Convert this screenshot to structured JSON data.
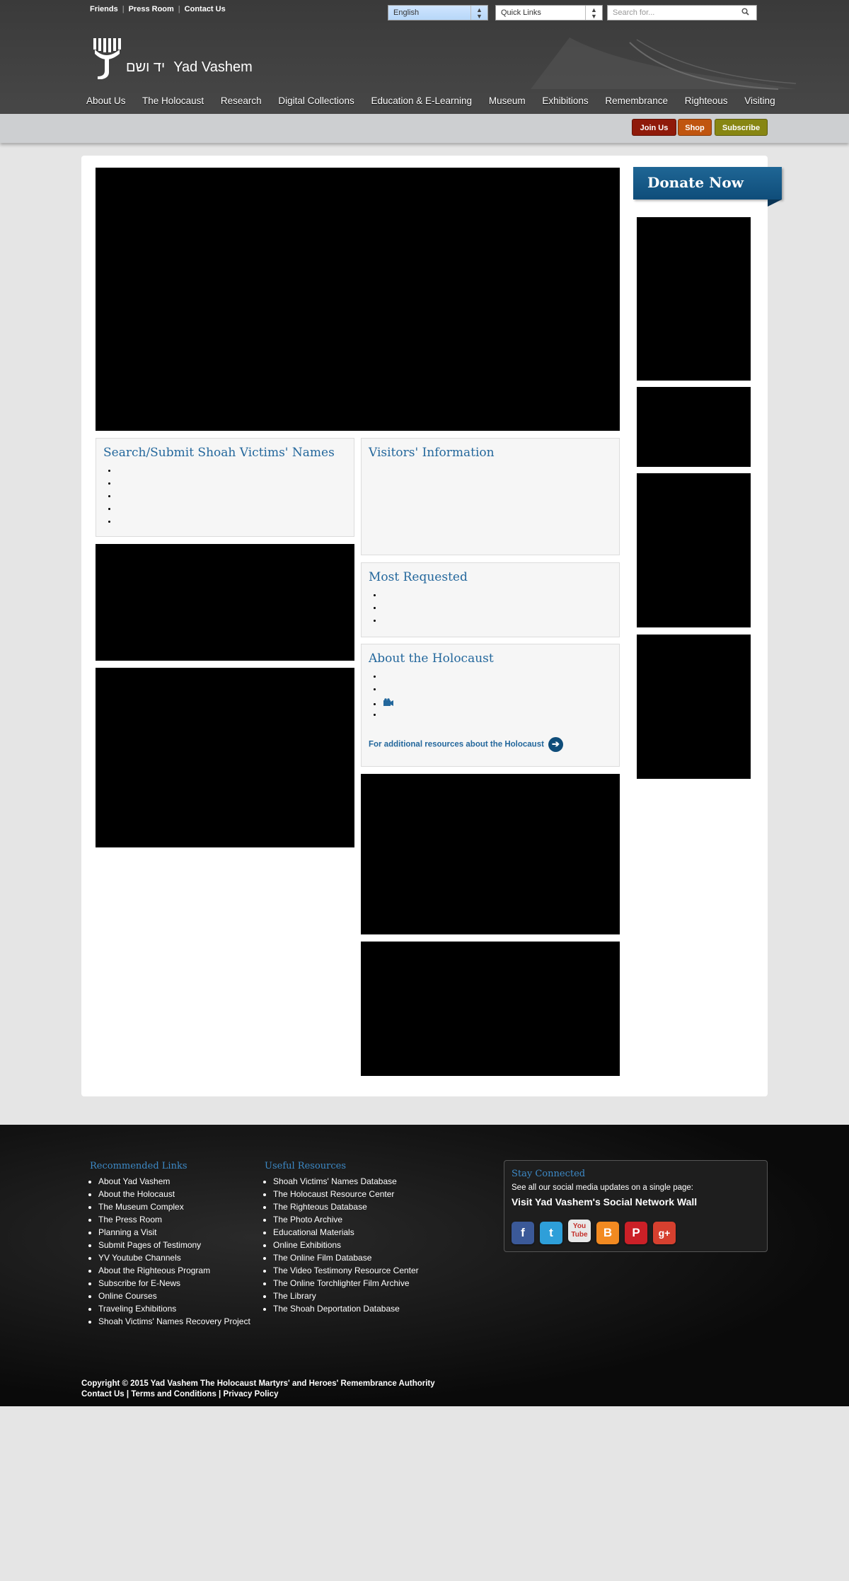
{
  "top_links": [
    "Friends",
    "Press Room",
    "Contact Us"
  ],
  "language_select": {
    "value": "English"
  },
  "quick_links_select": {
    "value": "Quick Links"
  },
  "search": {
    "placeholder": "Search for..."
  },
  "logo": {
    "hebrew": "יד ושם",
    "name": "Yad Vashem"
  },
  "nav": [
    "About Us",
    "The Holocaust",
    "Research",
    "Digital Collections",
    "Education & E-Learning",
    "Museum",
    "Exhibitions",
    "Remembrance",
    "Righteous",
    "Visiting"
  ],
  "subbar": {
    "join": "Join Us",
    "shop": "Shop",
    "subscribe": "Subscribe"
  },
  "donate": "Donate Now",
  "boxes": {
    "search_names": {
      "title": "Search/Submit Shoah Victims' Names"
    },
    "visitors": {
      "title": "Visitors' Information"
    },
    "most_requested": {
      "title": "Most Requested"
    },
    "about_holocaust": {
      "title": "About the Holocaust",
      "more_link": "For additional resources about the Holocaust"
    }
  },
  "footer": {
    "recommended": {
      "title": "Recommended Links",
      "items": [
        "About Yad Vashem",
        "About the Holocaust",
        "The Museum Complex",
        "The Press Room",
        "Planning a Visit",
        "Submit Pages of Testimony",
        "YV Youtube Channels",
        "About the Righteous Program",
        "Subscribe for E-News",
        "Online Courses",
        "Traveling Exhibitions",
        "Shoah Victims' Names Recovery Project"
      ]
    },
    "useful": {
      "title": "Useful Resources",
      "items": [
        "Shoah Victims' Names Database",
        "The Holocaust Resource Center",
        "The Righteous Database",
        "The Photo Archive",
        "Educational Materials",
        "Online Exhibitions",
        "The Online Film Database",
        "The Video Testimony Resource Center",
        "The Online Torchlighter Film Archive",
        "The Library",
        "The Shoah Deportation Database"
      ]
    },
    "stay": {
      "title": "Stay Connected",
      "text": "See all our social media updates on a single page:",
      "link": "Visit Yad Vashem's Social Network Wall"
    },
    "copyright": "Copyright © 2015 Yad Vashem The Holocaust Martyrs' and Heroes' Remembrance Authority",
    "legal_links": [
      "Contact Us",
      "Terms and Conditions",
      "Privacy Policy"
    ]
  }
}
